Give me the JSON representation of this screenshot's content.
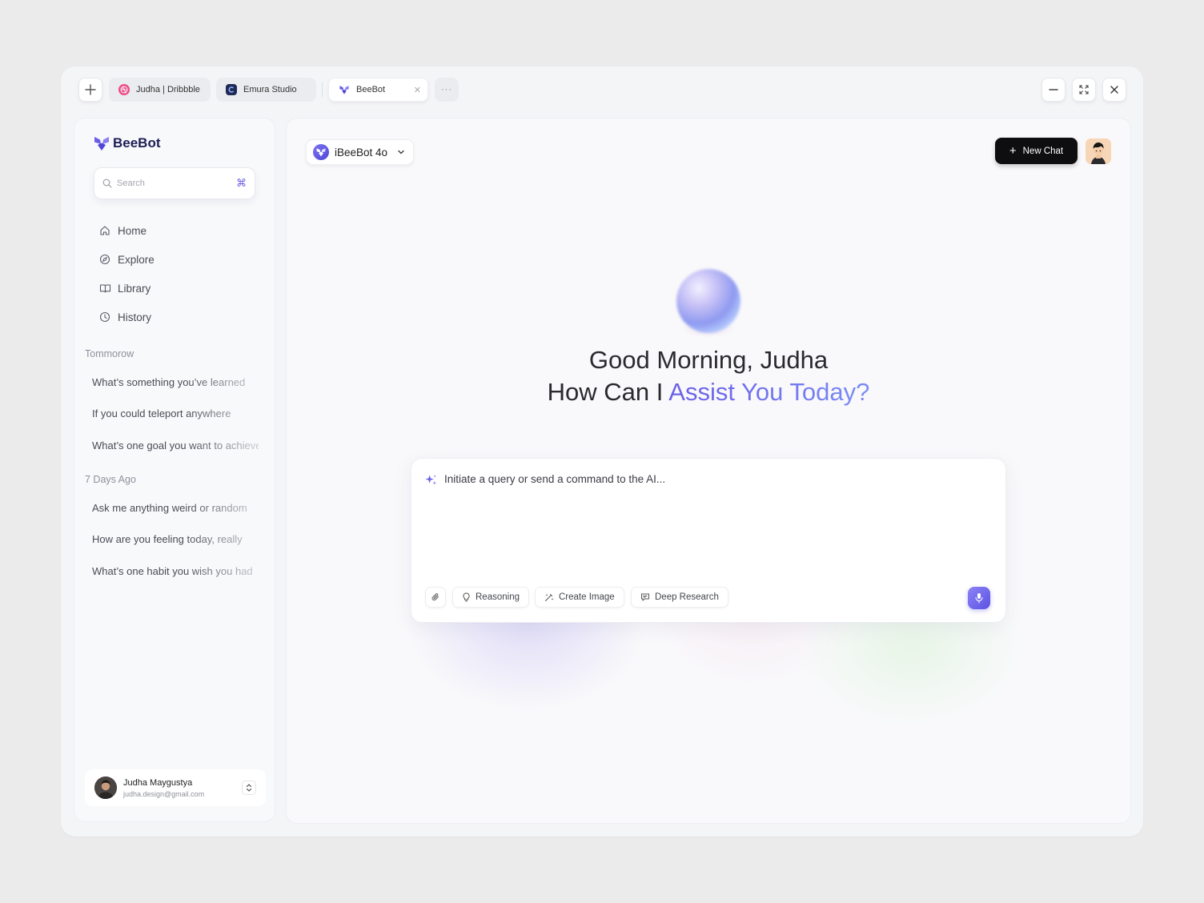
{
  "tabs": [
    {
      "label": "Judha | Dribbble",
      "favicon": "dribbble-icon",
      "active": false
    },
    {
      "label": "Emura Studio",
      "favicon": "emura-icon",
      "active": false
    },
    {
      "label": "BeeBot",
      "favicon": "beebot-icon",
      "active": true
    }
  ],
  "sidebar": {
    "brand": "BeeBot",
    "search_placeholder": "Search",
    "nav": [
      {
        "label": "Home",
        "icon": "home-icon"
      },
      {
        "label": "Explore",
        "icon": "compass-icon"
      },
      {
        "label": "Library",
        "icon": "book-icon"
      },
      {
        "label": "History",
        "icon": "clock-icon"
      }
    ],
    "sections": [
      {
        "label": "Tommorow",
        "items": [
          "What’s something you’ve learned",
          "If you could teleport anywhere",
          "What’s one goal you want to achieve"
        ]
      },
      {
        "label": "7 Days Ago",
        "items": [
          "Ask me anything weird or random",
          "How are you feeling today, really",
          "What’s one habit you wish you had"
        ]
      }
    ],
    "user": {
      "name": "Judha Maygustya",
      "email": "judha.design@gmail.com"
    }
  },
  "main": {
    "model": "iBeeBot 4o",
    "new_chat": "New Chat",
    "greeting_line1": "Good Morning, Judha",
    "greeting_line2_plain": "How Can I ",
    "greeting_line2_accent": "Assist You Today?",
    "composer_placeholder": "Initiate a query or send a command to the AI...",
    "chips": [
      "Reasoning",
      "Create Image",
      "Deep Research"
    ]
  },
  "colors": {
    "accent": "#6a5ee8",
    "brand": "#1d1f55",
    "new_chat_bg": "#0e0e10"
  }
}
